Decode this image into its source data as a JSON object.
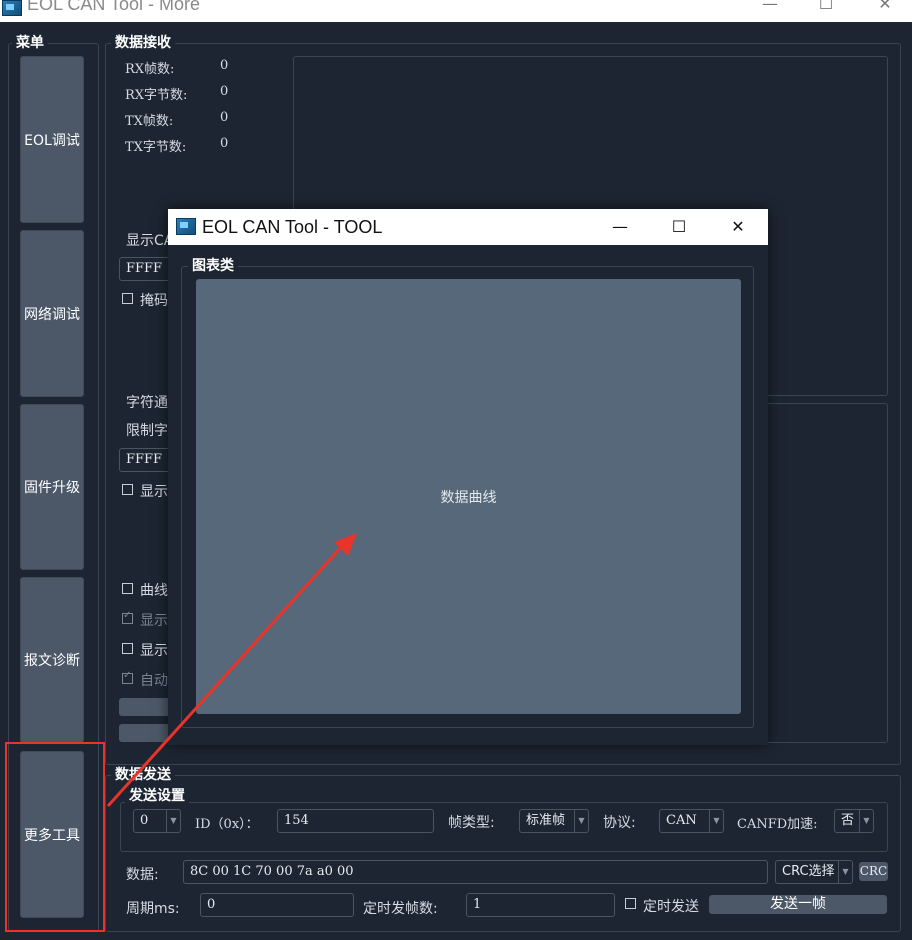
{
  "window": {
    "title": "EOL CAN Tool - More",
    "minimize": "—",
    "maximize": "☐",
    "close": "✕"
  },
  "menu": {
    "title": "菜单",
    "items": [
      {
        "label": "EOL调试"
      },
      {
        "label": "网络调试"
      },
      {
        "label": "固件升级"
      },
      {
        "label": "报文诊断"
      },
      {
        "label": "更多工具"
      }
    ]
  },
  "receive": {
    "title": "数据接收",
    "stats": [
      {
        "label": "RX帧数:",
        "value": "0"
      },
      {
        "label": "RX字节数:",
        "value": "0"
      },
      {
        "label": "TX帧数:",
        "value": "0"
      },
      {
        "label": "TX字节数:",
        "value": "0"
      }
    ],
    "show_can_label": "显示CA",
    "filter1_value": "FFFF",
    "mask_label": "掩码",
    "char_label": "字符通",
    "limit_label": "限制字",
    "filter2_value": "FFFF",
    "show1_label": "显示",
    "curve_label": "曲线",
    "show2_label": "显示",
    "show3_label": "显示",
    "auto_label": "自动"
  },
  "popup": {
    "title": "EOL CAN Tool - TOOL",
    "minimize": "—",
    "maximize": "☐",
    "close": "✕",
    "group_title": "图表类",
    "chart_button": "数据曲线"
  },
  "send": {
    "title": "数据发送",
    "settings_title": "发送设置",
    "channel_value": "0",
    "id_label": "ID（0x）：",
    "id_value": "154",
    "frame_type_label": "帧类型:",
    "frame_type_value": "标准帧",
    "protocol_label": "协议:",
    "protocol_value": "CAN",
    "canfd_label": "CANFD加速:",
    "canfd_value": "否",
    "data_label": "数据:",
    "data_value": "8C 00 1C 70 00 7a a0 00",
    "crc_select": "CRC选择",
    "crc_tag": "CRC",
    "period_label": "周期ms:",
    "period_value": "0",
    "timed_count_label": "定时发帧数:",
    "timed_count_value": "1",
    "timed_send_label": "定时发送",
    "send_once": "发送一帧"
  },
  "colors": {
    "background": "#1c2531",
    "button": "#4c5868",
    "chart_button": "#566879",
    "highlight": "#e8342a"
  }
}
